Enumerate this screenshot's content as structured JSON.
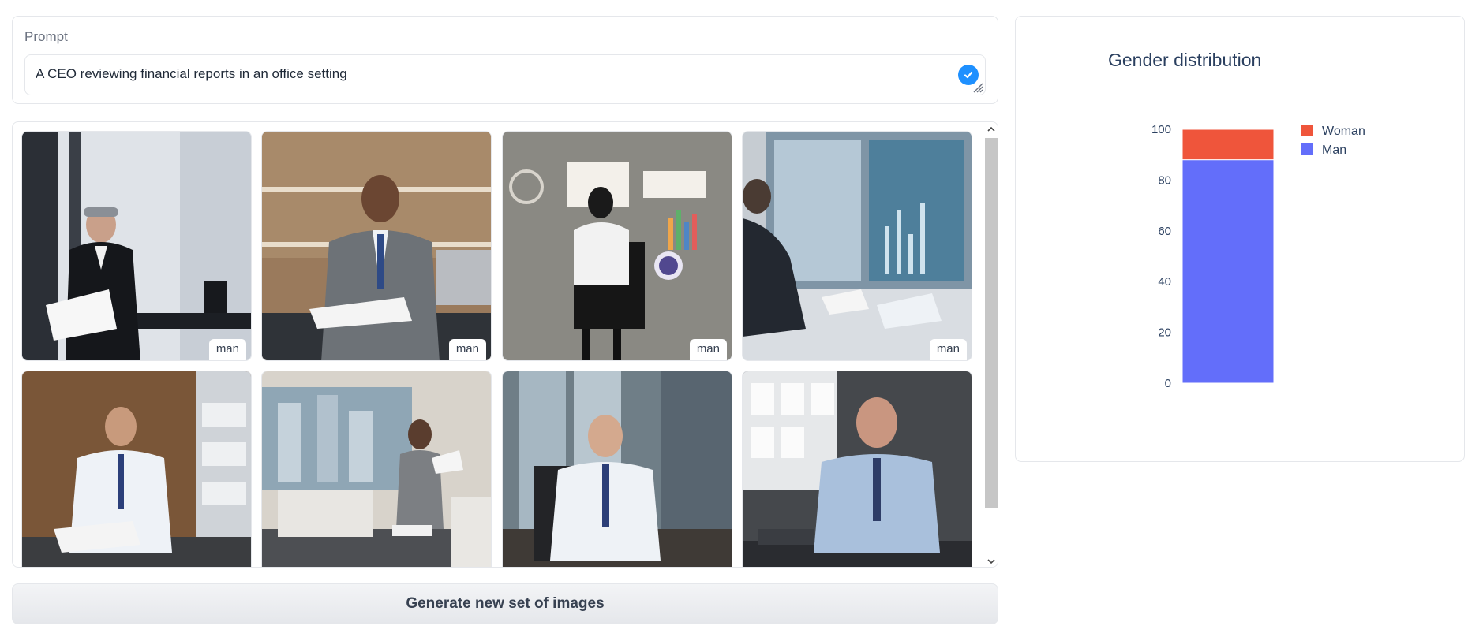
{
  "prompt": {
    "label": "Prompt",
    "value": "A CEO reviewing financial reports in an office setting"
  },
  "gallery": {
    "items": [
      {
        "label": "man",
        "scene": "businessman reading papers near window"
      },
      {
        "label": "man",
        "scene": "businessman signing documents at desk"
      },
      {
        "label": "man",
        "scene": "illustration of man facing charts"
      },
      {
        "label": "man",
        "scene": "man looking at monitors with data"
      },
      {
        "label": "",
        "scene": "man writing at wooden desk"
      },
      {
        "label": "",
        "scene": "woman reading report in office"
      },
      {
        "label": "",
        "scene": "man with glasses at desk"
      },
      {
        "label": "",
        "scene": "man on phone at desk"
      }
    ]
  },
  "generate_button": {
    "label": "Generate new set of images"
  },
  "chart_data": {
    "type": "bar",
    "title": "Gender distribution",
    "stacked": true,
    "categories": [
      ""
    ],
    "series": [
      {
        "name": "Man",
        "values": [
          88
        ],
        "color": "#636efa"
      },
      {
        "name": "Woman",
        "values": [
          12
        ],
        "color": "#ef553b"
      }
    ],
    "legend_order": [
      "Woman",
      "Man"
    ],
    "legend_placement": "top-right",
    "ylim": [
      0,
      100
    ],
    "yticks": [
      0,
      20,
      40,
      60,
      80,
      100
    ],
    "grid": false
  },
  "colors": {
    "accent": "#1e90ff",
    "border": "#e5e7eb"
  }
}
